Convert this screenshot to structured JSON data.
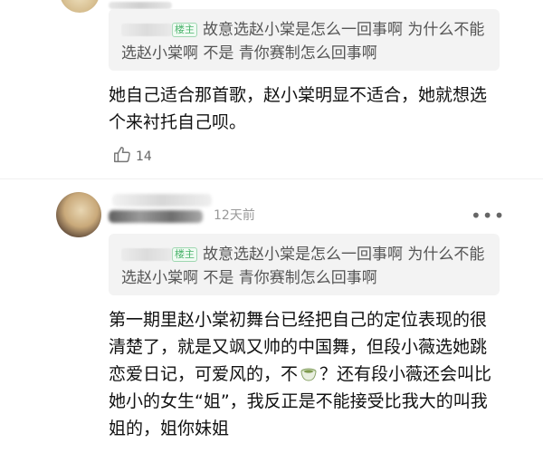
{
  "comments": [
    {
      "quote": {
        "badge": "楼主",
        "text": "故意选赵小棠是怎么一回事啊 为什么不能选赵小棠啊 不是 青你赛制怎么回事啊"
      },
      "body": "她自己适合那首歌，赵小棠明显不适合，她就想选个来衬托自己呗。",
      "likes": "14"
    },
    {
      "time": "12天前",
      "more": "•••",
      "quote": {
        "badge": "楼主",
        "text": "故意选赵小棠是怎么一回事啊 为什么不能选赵小棠啊 不是 青你赛制怎么回事啊"
      },
      "body_part1": "第一期里赵小棠初舞台已经把自己的定位表现的很清楚了，就是又飒又帅的中国舞，但段小薇选她跳恋爱日记，可爱风的，不",
      "body_part2": "？还有段小薇还会叫比她小的女生“姐”，我反正是不能接受比我大的叫我姐的，姐你妹姐"
    }
  ],
  "icons": {
    "like": "thumb-up-icon",
    "more": "more-dots-icon",
    "emoji": "tea-cup-emoji-icon"
  }
}
